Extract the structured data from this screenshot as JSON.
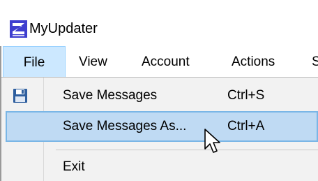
{
  "window": {
    "title": "MyUpdater",
    "icon": "app-logo-icon"
  },
  "menubar": {
    "items": [
      {
        "label": "File",
        "active": true
      },
      {
        "label": "View"
      },
      {
        "label": "Account"
      },
      {
        "label": "Actions"
      },
      {
        "label": "S"
      }
    ]
  },
  "file_menu": {
    "items": [
      {
        "label": "Save Messages",
        "shortcut": "Ctrl+S",
        "icon": "save-icon"
      },
      {
        "label": "Save Messages As...",
        "shortcut": "Ctrl+A",
        "highlighted": true
      },
      {
        "label": "Exit",
        "shortcut": ""
      }
    ]
  },
  "colors": {
    "menu_highlight": "#cce8ff",
    "item_highlight": "#bfdaf3",
    "item_highlight_border": "#7ab6e6",
    "app_icon": "#3f3fcf"
  }
}
